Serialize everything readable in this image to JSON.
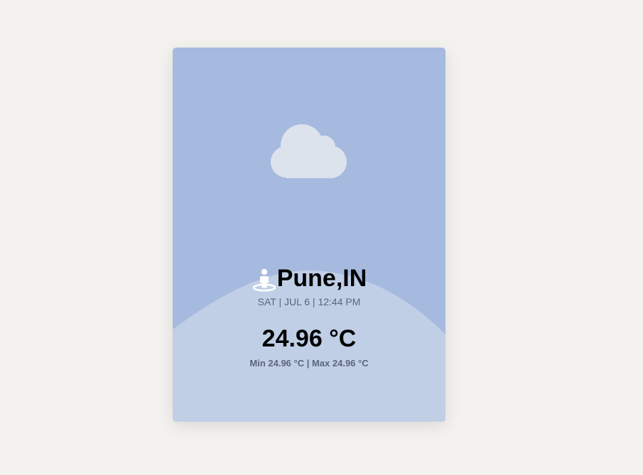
{
  "weather": {
    "condition_icon": "cloud-icon",
    "location_icon": "person-pin-icon",
    "city": "Pune,IN",
    "datetime": "SAT | JUL 6 | 12:44 PM",
    "temperature": "24.96 °C",
    "min_max": "Min 24.96 °C | Max 24.96 °C"
  },
  "colors": {
    "page_background": "#f3f2ef",
    "sky": "#a6badf",
    "hill": "#c0cfe6",
    "cloud": "#dde3ec",
    "secondary_text": "#5d6678"
  }
}
